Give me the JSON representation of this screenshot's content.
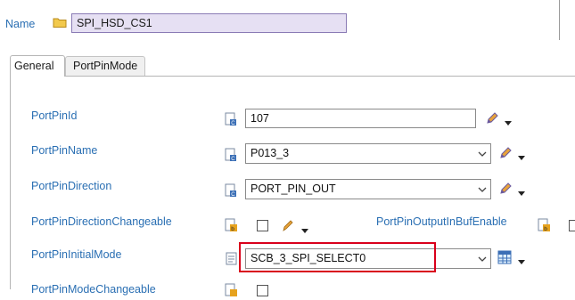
{
  "header": {
    "name_label": "Name",
    "name_value": "SPI_HSD_CS1"
  },
  "tabs": [
    {
      "label": "General"
    },
    {
      "label": "PortPinMode"
    }
  ],
  "fields": {
    "port_pin_id": {
      "label": "PortPinId",
      "value": "107"
    },
    "port_pin_name": {
      "label": "PortPinName",
      "value": "P013_3"
    },
    "port_pin_direction": {
      "label": "PortPinDirection",
      "value": "PORT_PIN_OUT"
    },
    "port_pin_direction_changeable": {
      "label": "PortPinDirectionChangeable"
    },
    "port_pin_output_in_buf_enable": {
      "label": "PortPinOutputInBufEnable"
    },
    "port_pin_initial_mode": {
      "label": "PortPinInitialMode",
      "value": "SCB_3_SPI_SELECT0"
    },
    "port_pin_mode_changeable": {
      "label": "PortPinModeChangeable"
    }
  },
  "colors": {
    "link": "#2a6fb3",
    "highlight": "#d9001b",
    "name_bg": "#e6e0f3"
  }
}
